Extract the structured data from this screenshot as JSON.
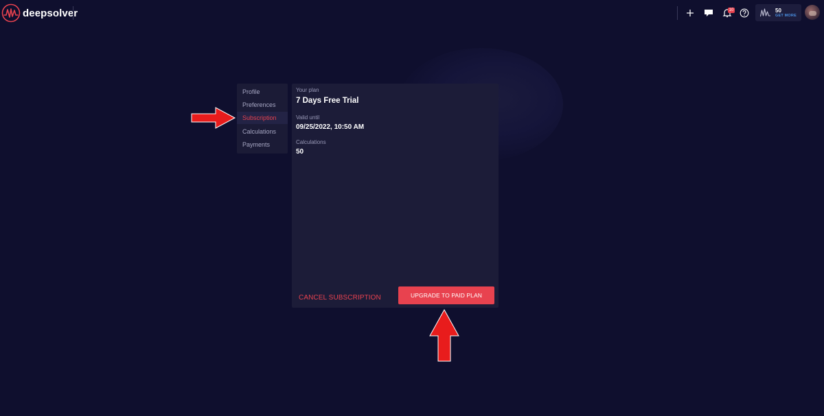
{
  "app": {
    "logo_text": "deepsolver"
  },
  "header": {
    "notification_count": "10",
    "credits": {
      "count": "50",
      "label": "GET MORE"
    },
    "icons": [
      "plus-icon",
      "chat-icon",
      "bell-icon",
      "help-icon",
      "waveform-icon",
      "avatar"
    ]
  },
  "sidebar": {
    "items": [
      {
        "label": "Profile",
        "active": false
      },
      {
        "label": "Preferences",
        "active": false
      },
      {
        "label": "Subscription",
        "active": true
      },
      {
        "label": "Calculations",
        "active": false
      },
      {
        "label": "Payments",
        "active": false
      }
    ]
  },
  "subscription": {
    "plan_label": "Your plan",
    "plan_value": "7 Days Free Trial",
    "valid_label": "Valid until",
    "valid_value": "09/25/2022, 10:50 AM",
    "calc_label": "Calculations",
    "calc_value": "50",
    "cancel_label": "CANCEL SUBSCRIPTION",
    "upgrade_label": "UPGRADE TO PAID PLAN"
  },
  "colors": {
    "background": "#0f0f2e",
    "panel": "#1c1c38",
    "accent": "#e8424f",
    "link_blue": "#4a90e2"
  }
}
